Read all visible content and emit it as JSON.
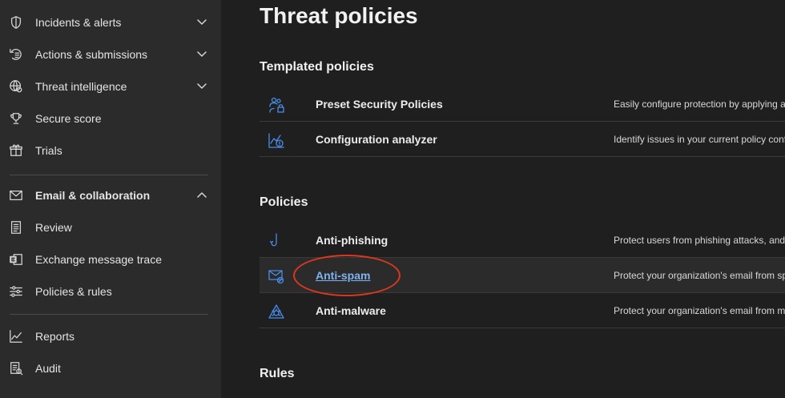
{
  "sidebar": {
    "items": [
      {
        "label": "Incidents & alerts",
        "icon": "shield-icon",
        "chevron": "down"
      },
      {
        "label": "Actions & submissions",
        "icon": "actions-icon",
        "chevron": "down"
      },
      {
        "label": "Threat intelligence",
        "icon": "globe-icon",
        "chevron": "down"
      },
      {
        "label": "Secure score",
        "icon": "trophy-icon"
      },
      {
        "label": "Trials",
        "icon": "gift-icon"
      },
      {
        "label": "Email & collaboration",
        "icon": "mail-icon",
        "chevron": "up"
      },
      {
        "label": "Review",
        "icon": "review-icon"
      },
      {
        "label": "Exchange message trace",
        "icon": "exchange-icon"
      },
      {
        "label": "Policies & rules",
        "icon": "sliders-icon"
      },
      {
        "label": "Reports",
        "icon": "chart-line-icon"
      },
      {
        "label": "Audit",
        "icon": "audit-icon"
      }
    ]
  },
  "main": {
    "title": "Threat policies",
    "templated": {
      "heading": "Templated policies",
      "rows": [
        {
          "name": "Preset Security Policies",
          "desc": "Easily configure protection by applying a",
          "icon": "people-lock-icon"
        },
        {
          "name": "Configuration analyzer",
          "desc": "Identify issues in your current policy conf",
          "icon": "analyzer-icon"
        }
      ]
    },
    "policies": {
      "heading": "Policies",
      "rows": [
        {
          "name": "Anti-phishing",
          "desc": "Protect users from phishing attacks, and",
          "icon": "hook-icon"
        },
        {
          "name": "Anti-spam",
          "desc": "Protect your organization's email from sp",
          "icon": "mail-block-icon"
        },
        {
          "name": "Anti-malware",
          "desc": "Protect your organization's email from m",
          "icon": "bug-icon"
        }
      ]
    },
    "rules": {
      "heading": "Rules"
    }
  },
  "colors": {
    "accent": "#4a8de8",
    "link": "#7fb2f0",
    "annotation": "#d9381e"
  }
}
